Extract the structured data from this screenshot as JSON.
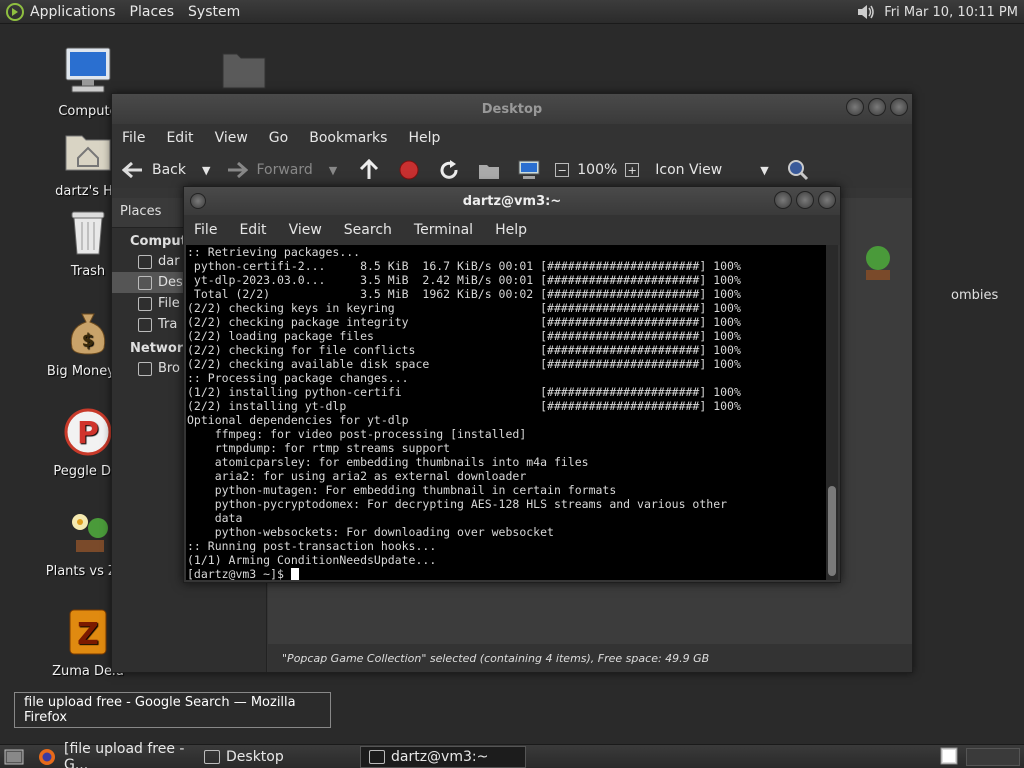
{
  "top_panel": {
    "menus": [
      "Applications",
      "Places",
      "System"
    ],
    "clock": "Fri Mar 10, 10:11 PM"
  },
  "desktop_icons": [
    {
      "label": "Compute",
      "icon": "computer-icon"
    },
    {
      "label": "dartz's Ho",
      "icon": "home-folder-icon"
    },
    {
      "label": "Trash",
      "icon": "trash-icon"
    },
    {
      "label": "Big Money D",
      "icon": "money-bag-icon"
    },
    {
      "label": "Peggle Del",
      "icon": "peggle-icon"
    },
    {
      "label": "Plants vs Zor",
      "icon": "plants-icon"
    },
    {
      "label": "Zuma Delu",
      "icon": "zuma-icon"
    }
  ],
  "file_manager": {
    "title": "Desktop",
    "menu": [
      "File",
      "Edit",
      "View",
      "Go",
      "Bookmarks",
      "Help"
    ],
    "toolbar": {
      "back": "Back",
      "forward": "Forward",
      "zoom": "100%",
      "view_mode": "Icon View"
    },
    "sidebar": {
      "header": "Places",
      "sections": [
        {
          "title": "Compute",
          "items": [
            "dar",
            "Des",
            "File",
            "Tra"
          ]
        },
        {
          "title": "Network",
          "items": [
            "Bro"
          ]
        }
      ]
    },
    "main_partial_label": "ombies",
    "status": "\"Popcap Game Collection\" selected (containing 4 items), Free space: 49.9 GB"
  },
  "terminal": {
    "title": "dartz@vm3:~",
    "menu": [
      "File",
      "Edit",
      "View",
      "Search",
      "Terminal",
      "Help"
    ],
    "lines": [
      ":: Retrieving packages...",
      " python-certifi-2...     8.5 KiB  16.7 KiB/s 00:01 [######################] 100%",
      " yt-dlp-2023.03.0...     3.5 MiB  2.42 MiB/s 00:01 [######################] 100%",
      " Total (2/2)             3.5 MiB  1962 KiB/s 00:02 [######################] 100%",
      "(2/2) checking keys in keyring                     [######################] 100%",
      "(2/2) checking package integrity                   [######################] 100%",
      "(2/2) loading package files                        [######################] 100%",
      "(2/2) checking for file conflicts                  [######################] 100%",
      "(2/2) checking available disk space                [######################] 100%",
      ":: Processing package changes...",
      "(1/2) installing python-certifi                    [######################] 100%",
      "(2/2) installing yt-dlp                            [######################] 100%",
      "Optional dependencies for yt-dlp",
      "    ffmpeg: for video post-processing [installed]",
      "    rtmpdump: for rtmp streams support",
      "    atomicparsley: for embedding thumbnails into m4a files",
      "    aria2: for using aria2 as external downloader",
      "    python-mutagen: For embedding thumbnail in certain formats",
      "    python-pycryptodomex: For decrypting AES-128 HLS streams and various other",
      "    data",
      "    python-websockets: For downloading over websocket",
      ":: Running post-transaction hooks...",
      "(1/1) Arming ConditionNeedsUpdate..."
    ],
    "prompt": "[dartz@vm3 ~]$ "
  },
  "tooltip": "file upload free - Google Search — Mozilla Firefox",
  "taskbar": [
    {
      "label": "[file upload free - G...",
      "active": false
    },
    {
      "label": "Desktop",
      "active": false
    },
    {
      "label": "dartz@vm3:~",
      "active": true
    }
  ]
}
